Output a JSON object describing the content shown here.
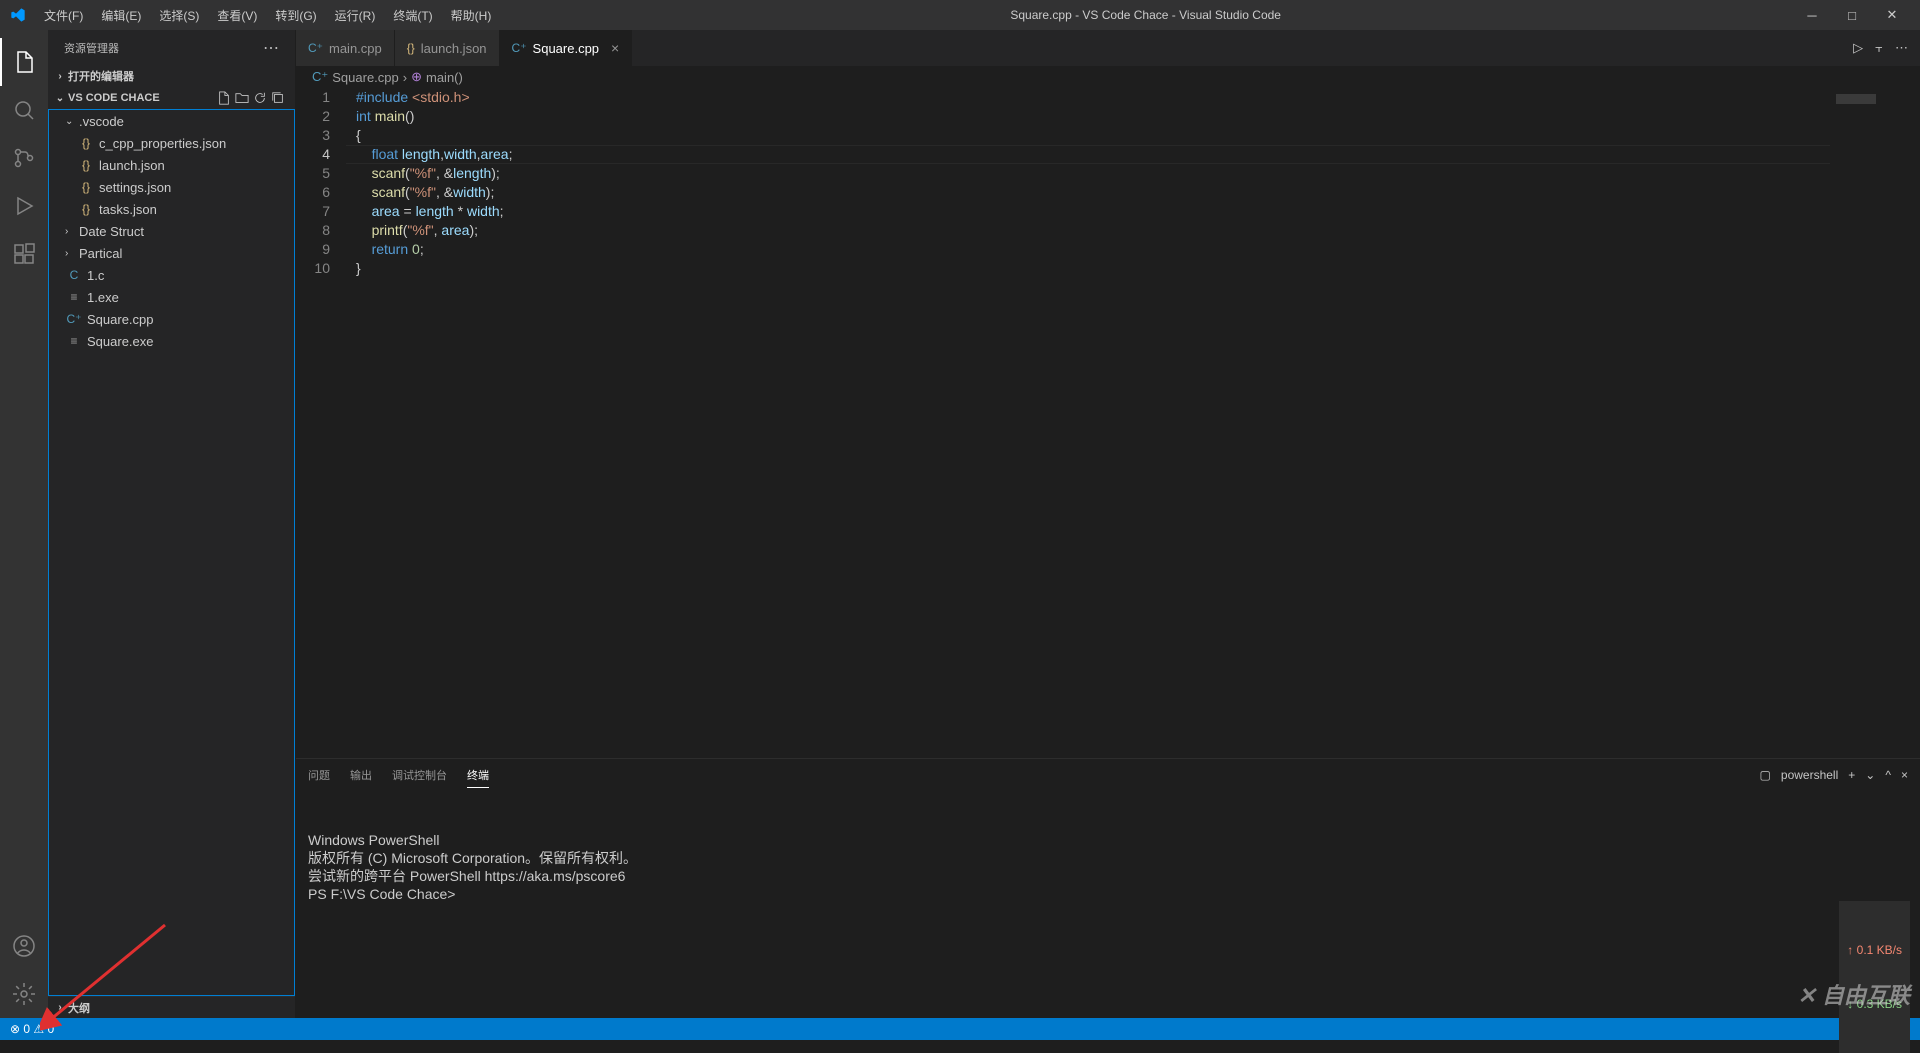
{
  "window": {
    "title": "Square.cpp - VS Code Chace - Visual Studio Code"
  },
  "menubar": [
    "文件(F)",
    "编辑(E)",
    "选择(S)",
    "查看(V)",
    "转到(G)",
    "运行(R)",
    "终端(T)",
    "帮助(H)"
  ],
  "sidebar": {
    "title": "资源管理器",
    "sections": {
      "open_editors": "打开的编辑器",
      "workspace": "VS CODE CHACE",
      "outline": "大纲"
    },
    "tree": [
      {
        "type": "folder",
        "name": ".vscode",
        "expanded": true,
        "indent": 1
      },
      {
        "type": "json",
        "name": "c_cpp_properties.json",
        "indent": 2
      },
      {
        "type": "json",
        "name": "launch.json",
        "indent": 2
      },
      {
        "type": "json",
        "name": "settings.json",
        "indent": 2
      },
      {
        "type": "json",
        "name": "tasks.json",
        "indent": 2
      },
      {
        "type": "folder",
        "name": "Date Struct",
        "expanded": false,
        "indent": 1
      },
      {
        "type": "folder",
        "name": "Partical",
        "expanded": false,
        "indent": 1
      },
      {
        "type": "c",
        "name": "1.c",
        "indent": 1
      },
      {
        "type": "exe",
        "name": "1.exe",
        "indent": 1
      },
      {
        "type": "cpp",
        "name": "Square.cpp",
        "indent": 1
      },
      {
        "type": "exe",
        "name": "Square.exe",
        "indent": 1
      }
    ]
  },
  "tabs": [
    {
      "icon": "cpp",
      "label": "main.cpp",
      "active": false
    },
    {
      "icon": "json",
      "label": "launch.json",
      "active": false
    },
    {
      "icon": "cpp",
      "label": "Square.cpp",
      "active": true
    }
  ],
  "breadcrumb": [
    "Square.cpp",
    "main()"
  ],
  "code": {
    "lines": [
      {
        "n": 1,
        "html": "<span class='kw'>#include</span> <span class='inc'>&lt;stdio.h&gt;</span>"
      },
      {
        "n": 2,
        "html": "<span class='type'>int</span> <span class='fn'>main</span>()"
      },
      {
        "n": 3,
        "html": "{"
      },
      {
        "n": 4,
        "html": "    <span class='type'>float</span> <span class='var'>length</span>,<span class='var'>width</span>,<span class='var'>area</span>;",
        "current": true
      },
      {
        "n": 5,
        "html": "    <span class='fn'>scanf</span>(<span class='str'>\"%f\"</span>, &amp;<span class='var'>length</span>);"
      },
      {
        "n": 6,
        "html": "    <span class='fn'>scanf</span>(<span class='str'>\"%f\"</span>, &amp;<span class='var'>width</span>);"
      },
      {
        "n": 7,
        "html": "    <span class='var'>area</span> = <span class='var'>length</span> * <span class='var'>width</span>;"
      },
      {
        "n": 8,
        "html": "    <span class='fn'>printf</span>(<span class='str'>\"%f\"</span>, <span class='var'>area</span>);"
      },
      {
        "n": 9,
        "html": "    <span class='kw'>return</span> <span class='num'>0</span>;"
      },
      {
        "n": 10,
        "html": "}"
      }
    ]
  },
  "panel": {
    "tabs": [
      "问题",
      "输出",
      "调试控制台",
      "终端"
    ],
    "active_tab": "终端",
    "shell_label": "powershell",
    "terminal_lines": [
      "Windows PowerShell",
      "版权所有 (C) Microsoft Corporation。保留所有权利。",
      "",
      "尝试新的跨平台 PowerShell https://aka.ms/pscore6",
      "",
      "PS F:\\VS Code Chace>"
    ]
  },
  "statusbar": {
    "left": "⊗ 0 ⚠ 0"
  },
  "net": {
    "up": "0.1 KB/s",
    "down": "0.3 KB/s"
  },
  "watermark": "自由互联"
}
